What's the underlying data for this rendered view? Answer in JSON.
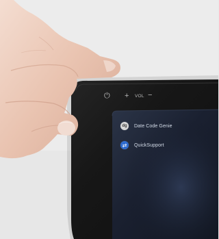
{
  "device": {
    "buttons": {
      "power_glyph": "⏻",
      "plus_label": "+",
      "vol_label": "VOL",
      "minus_label": "−"
    }
  },
  "screen": {
    "apps": [
      {
        "label": "Date Code Genie",
        "icon_glyph": "dg",
        "icon_name": "date-code-genie-icon",
        "icon_bg": "#d8d8d8",
        "icon_fg": "#3a3a3a"
      },
      {
        "label": "QuickSupport",
        "icon_glyph": "⇄",
        "icon_name": "quicksupport-icon",
        "icon_bg": "#2f6ccf",
        "icon_fg": "#ffffff"
      }
    ]
  },
  "colors": {
    "background": "#e9e9e9",
    "case": "#151515",
    "screen": "#1d2433"
  }
}
